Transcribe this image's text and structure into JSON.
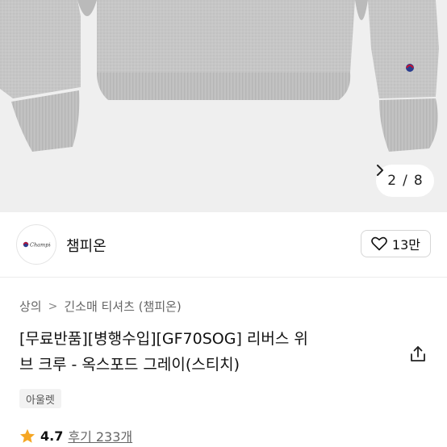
{
  "gallery": {
    "current": "2",
    "separator": "/",
    "total": "8",
    "next_icon": "chevron-right-icon",
    "background": "#efefef",
    "product_color": "#c4c4c4"
  },
  "brand": {
    "name": "챔피온",
    "logo_icon": "champion-logo-icon",
    "like_icon": "heart-outline-icon",
    "like_count": "13만"
  },
  "breadcrumb": {
    "level1": "상의",
    "separator": ">",
    "level2": "긴소매 티셔츠 (챔피온)"
  },
  "product": {
    "title_line1": "[무료반품][병행수입][GF70SOG] 리버스 위",
    "title_line2": "브 크루 - 옥스포드 그레이(스티치)",
    "share_icon": "share-icon",
    "tag": "아울렛"
  },
  "rating": {
    "star_icon": "star-icon",
    "score": "4.7",
    "reviews": "후기 233개",
    "star_color": "#f5a623"
  }
}
